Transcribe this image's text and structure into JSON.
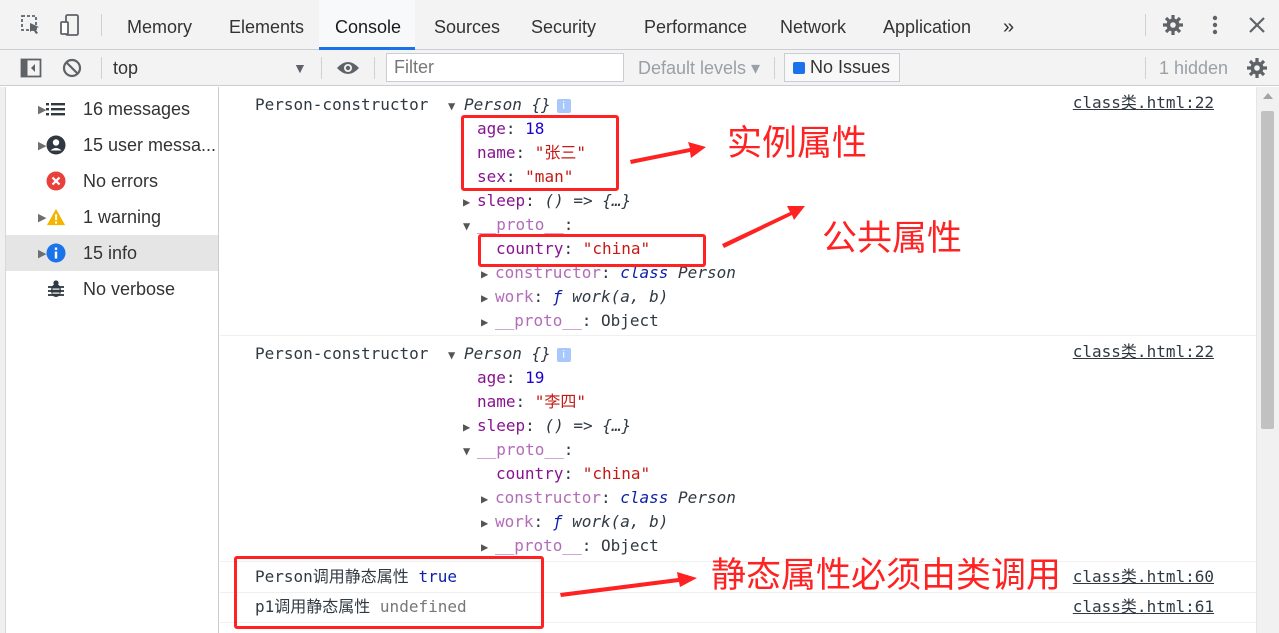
{
  "topbar": {
    "tabs": [
      "Memory",
      "Elements",
      "Console",
      "Sources",
      "Security",
      "Performance",
      "Network",
      "Application"
    ],
    "active_tab": "Console",
    "more_tabs_glyph": "»"
  },
  "toolbar": {
    "context": "top",
    "filter_placeholder": "Filter",
    "levels": "Default levels ▾",
    "issues": "No Issues",
    "hidden": "1 hidden"
  },
  "sidebar": {
    "items": [
      {
        "label": "16 messages",
        "icon": "list-icon"
      },
      {
        "label": "15 user messa...",
        "icon": "user-icon"
      },
      {
        "label": "No errors",
        "icon": "error-icon"
      },
      {
        "label": "1 warning",
        "icon": "warning-icon"
      },
      {
        "label": "15 info",
        "icon": "info-icon"
      },
      {
        "label": "No verbose",
        "icon": "bug-icon"
      }
    ]
  },
  "console": {
    "msg1": {
      "prefix": "Person-constructor",
      "obj": "Person {}",
      "src": "class类.html:22",
      "age_k": "age",
      "age_v": "18",
      "name_k": "name",
      "name_v": "\"张三\"",
      "sex_k": "sex",
      "sex_v": "\"man\"",
      "sleep_k": "sleep",
      "sleep_v": "() => {…}",
      "proto_k": "__proto__",
      "country_k": "country",
      "country_v": "\"china\"",
      "ctor_k": "constructor",
      "ctor_v1": "class",
      "ctor_v2": "Person",
      "work_k": "work",
      "work_v1": "ƒ",
      "work_v2": "work(a, b)",
      "proto2_k": "__proto__",
      "proto2_v": "Object"
    },
    "msg2": {
      "prefix": "Person-constructor",
      "obj": "Person {}",
      "src": "class类.html:22",
      "age_k": "age",
      "age_v": "19",
      "name_k": "name",
      "name_v": "\"李四\"",
      "sleep_k": "sleep",
      "sleep_v": "() => {…}",
      "proto_k": "__proto__",
      "country_k": "country",
      "country_v": "\"china\"",
      "ctor_k": "constructor",
      "ctor_v1": "class",
      "ctor_v2": "Person",
      "work_k": "work",
      "work_v1": "ƒ",
      "work_v2": "work(a, b)",
      "proto2_k": "__proto__",
      "proto2_v": "Object"
    },
    "msg3": {
      "text": "Person调用静态属性",
      "value": "true",
      "src": "class类.html:60"
    },
    "msg4": {
      "text": "p1调用静态属性",
      "value": "undefined",
      "src": "class类.html:61"
    }
  },
  "annotations": {
    "instance": "实例属性",
    "public": "公共属性",
    "static": "静态属性必须由类调用"
  },
  "colors": {
    "annotation": "#ff2222",
    "accent": "#1a73e8"
  }
}
